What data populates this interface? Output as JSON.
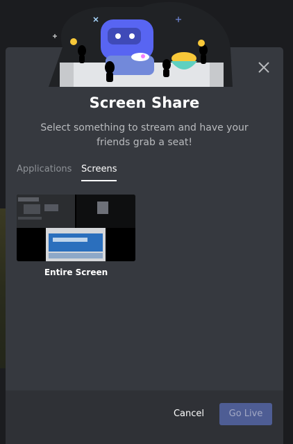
{
  "dialog": {
    "title": "Screen Share",
    "subtitle": "Select something to stream and have your friends grab a seat!"
  },
  "tabs": [
    {
      "label": "Applications",
      "active": false
    },
    {
      "label": "Screens",
      "active": true
    }
  ],
  "sources": [
    {
      "label": "Entire Screen"
    }
  ],
  "footer": {
    "cancel_label": "Cancel",
    "go_live_label": "Go Live"
  },
  "icons": {
    "close": "close-icon"
  },
  "colors": {
    "modal_bg": "#36393f",
    "footer_bg": "#2f3136",
    "go_live_bg": "#4e5d94",
    "hero_bg": "#202225"
  }
}
